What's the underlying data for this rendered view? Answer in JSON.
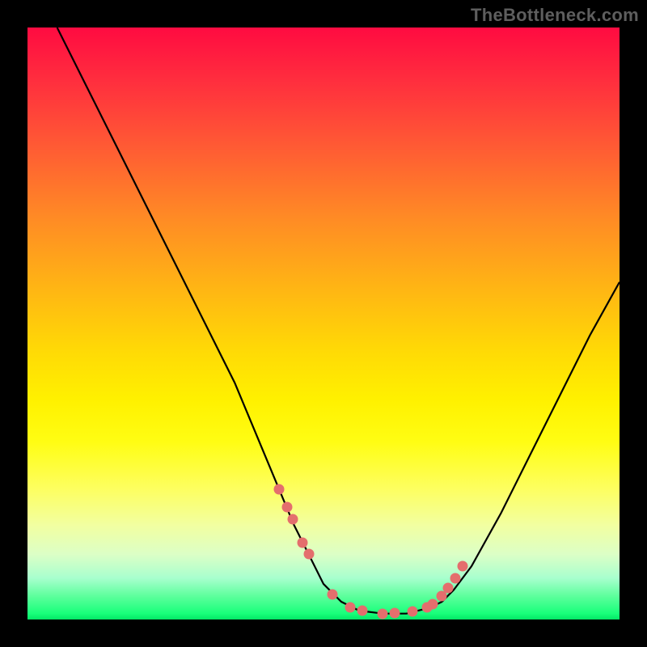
{
  "watermark": "TheBottleneck.com",
  "chart_data": {
    "type": "line",
    "title": "",
    "xlabel": "",
    "ylabel": "",
    "xlim": [
      0,
      100
    ],
    "ylim": [
      0,
      100
    ],
    "series": [
      {
        "name": "curve",
        "x": [
          5,
          10,
          15,
          20,
          25,
          30,
          35,
          40,
          45,
          48,
          50,
          53,
          56,
          60,
          64,
          68,
          70,
          72,
          75,
          80,
          85,
          90,
          95,
          100
        ],
        "y": [
          100,
          90,
          80,
          70,
          60,
          50,
          40,
          28,
          16,
          10,
          6,
          3,
          1.5,
          1,
          1,
          2,
          3,
          5,
          9,
          18,
          28,
          38,
          48,
          57
        ]
      },
      {
        "name": "dots",
        "x": [
          42.5,
          43.8,
          44.8,
          46.5,
          47.5,
          51.5,
          54.5,
          56.5,
          60.0,
          62.0,
          65.0,
          67.5,
          68.5,
          70.0,
          71.0,
          72.3,
          73.5
        ],
        "y": [
          22.0,
          19.0,
          17.0,
          13.0,
          11.0,
          4.2,
          2.0,
          1.5,
          1.0,
          1.1,
          1.3,
          2.0,
          2.6,
          4.0,
          5.3,
          7.0,
          9.0
        ]
      }
    ]
  }
}
